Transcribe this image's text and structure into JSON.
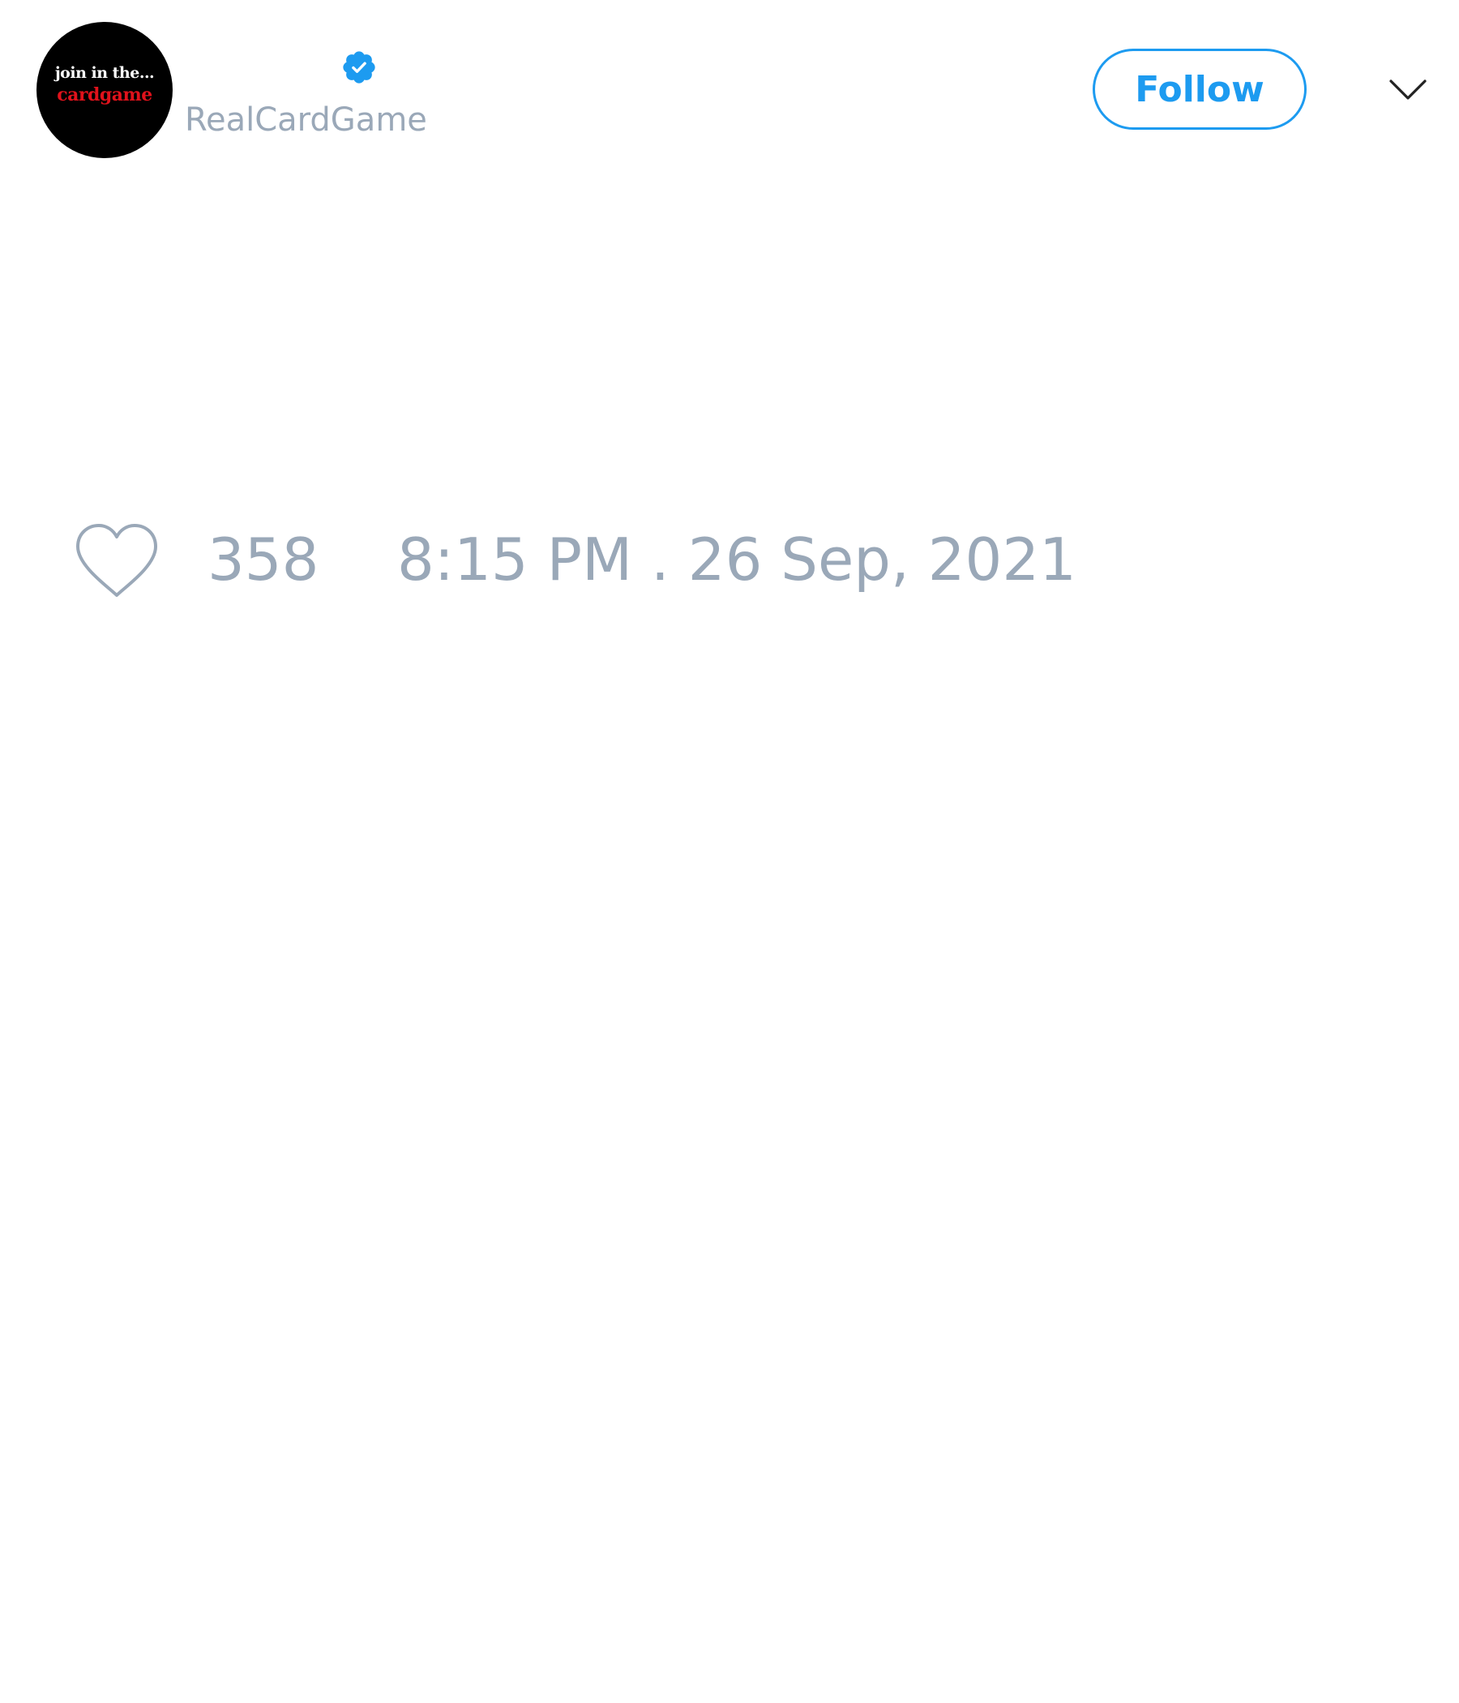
{
  "tweet": {
    "account": {
      "avatar_text_line1": "join in the...",
      "avatar_text_line2": "cardgame",
      "handle": "RealCardGame",
      "verified": true
    },
    "actions": {
      "follow_label": "Follow",
      "menu_icon": "chevron-down-icon"
    },
    "stats": {
      "like_icon": "heart-icon",
      "likes": "358",
      "timestamp": "8:15 PM . 26 Sep, 2021"
    }
  },
  "colors": {
    "accent": "#1d9bf0",
    "muted_text": "#9aa8b8",
    "avatar_background": "#000000",
    "avatar_highlight": "#e0121b"
  }
}
